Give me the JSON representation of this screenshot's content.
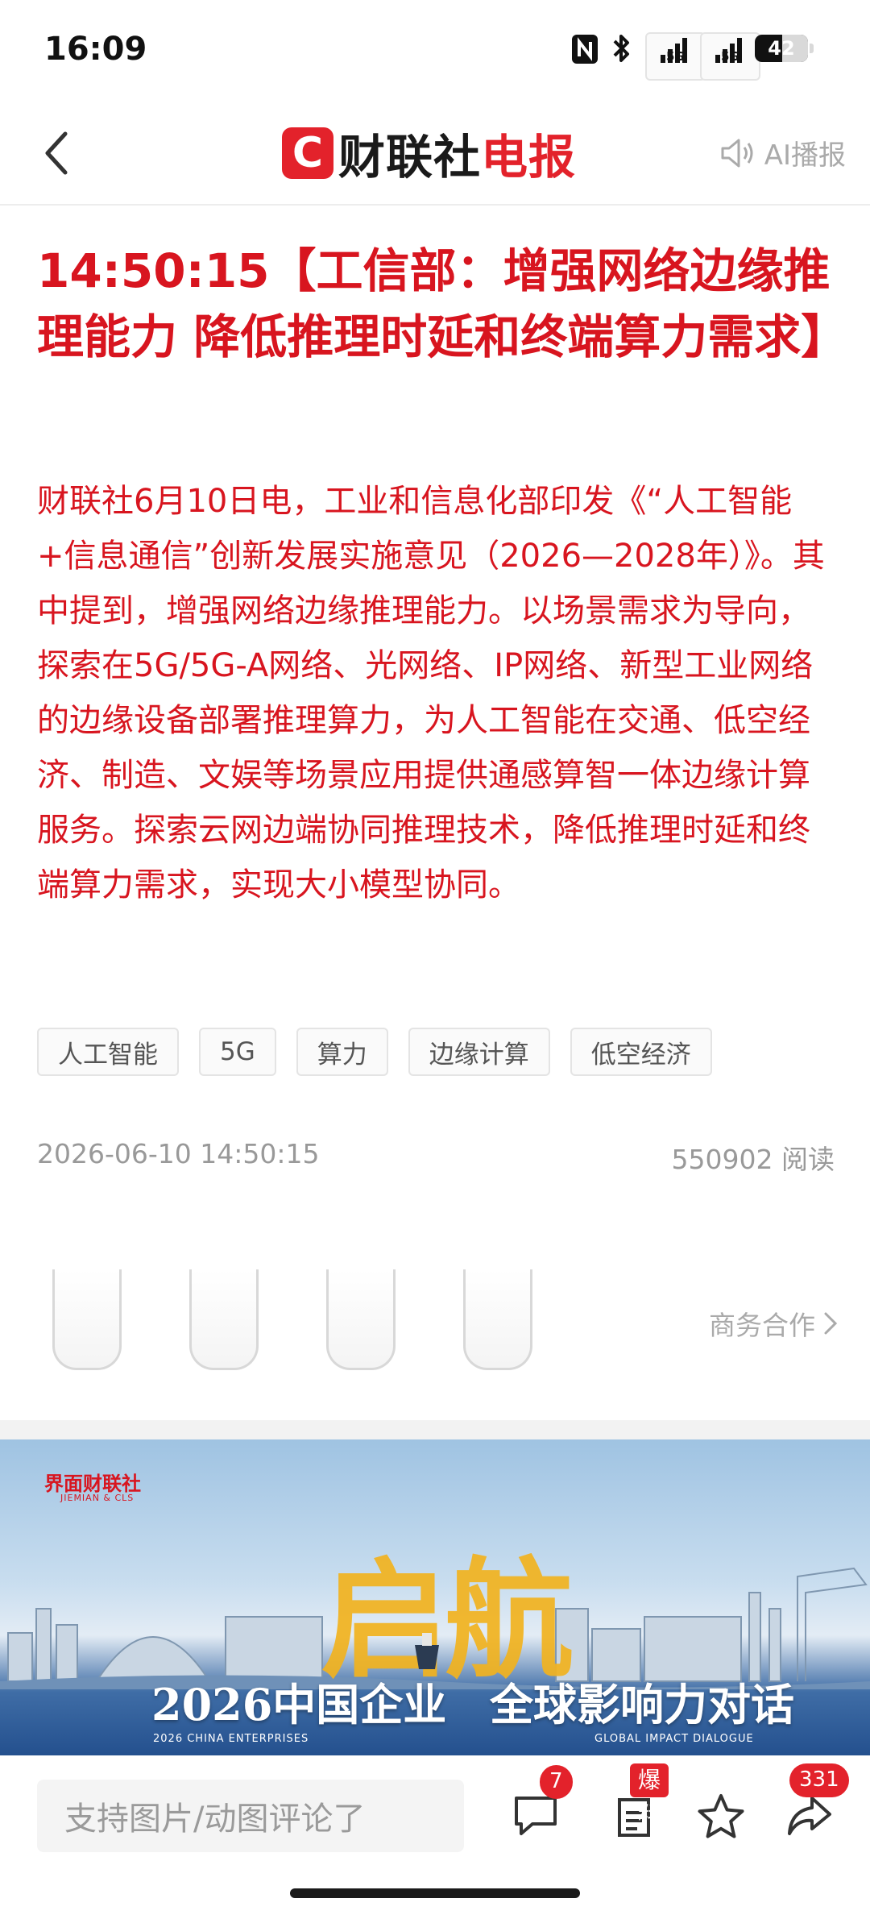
{
  "status_bar": {
    "time": "16:09",
    "net1": "5G",
    "net2": "5G",
    "battery": "42"
  },
  "header": {
    "logo_mark": "C",
    "logo_text_a": "财联社",
    "logo_text_b": "电报",
    "ai_play_label": "AI播报",
    "brand_red": "#e3222b"
  },
  "article": {
    "headline": "14:50:15【工信部：增强网络边缘推理能力 降低推理时延和终端算力需求】",
    "body": "财联社6月10日电，工业和信息化部印发《“人工智能+信息通信”创新发展实施意见（2026—2028年）》。其中提到，增强网络边缘推理能力。以场景需求为导向，探索在5G/5G-A网络、光网络、IP网络、新型工业网络的边缘设备部署推理算力，为人工智能在交通、低空经济、制造、文娱等场景应用提供通感算智一体边缘计算服务。探索云网边端协同推理技术，降低推理时延和终端算力需求，实现大小模型协同。",
    "tags": [
      "人工智能",
      "5G",
      "算力",
      "边缘计算",
      "低空经济"
    ],
    "datetime": "2026-06-10 14:50:15",
    "reads": "550902 阅读",
    "text_color": "#d8151f"
  },
  "ad": {
    "business_label": "商务合作"
  },
  "banner": {
    "brand": "界面财联社",
    "brand_sub": "JIEMIAN & CLS",
    "big_text": "启航",
    "line_left": "2026中国企业",
    "line_right": "全球影响力对话",
    "en_left": "2026 CHINA ENTERPRISES",
    "en_right": "GLOBAL IMPACT DIALOGUE",
    "accent": "#f2b31f"
  },
  "bottom_bar": {
    "comment_placeholder": "支持图片/动图评论了",
    "comment_count": "7",
    "report_label": "爆料",
    "share_count": "331"
  }
}
